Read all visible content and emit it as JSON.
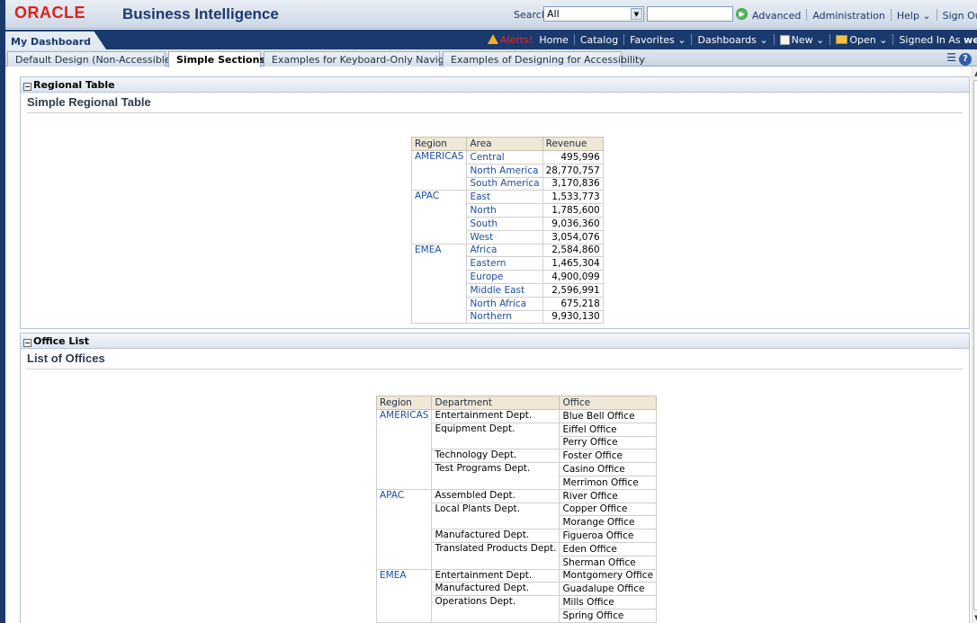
{
  "header": {
    "logo": "ORACLE",
    "app_title": "Business Intelligence",
    "search_label": "Search",
    "search_scope": "All",
    "links": [
      "Advanced",
      "Administration",
      "Help",
      "Sign Out"
    ]
  },
  "navbar": {
    "dashboard_tab": "My Dashboard",
    "alerts": "Alerts!",
    "home": "Home",
    "catalog": "Catalog",
    "favorites": "Favorites",
    "dashboards": "Dashboards",
    "new": "New",
    "open": "Open",
    "signed_in_label": "Signed In As",
    "user": "weblogic"
  },
  "page_tabs": [
    "Default Design (Non-Accessible)",
    "Simple Sections",
    "Examples for Keyboard-Only Navigation",
    "Examples of Designing for Accessibility"
  ],
  "active_tab": 1,
  "sections": {
    "regional": {
      "header": "Regional Table",
      "title": "Simple Regional Table",
      "columns": [
        "Region",
        "Area",
        "Revenue"
      ],
      "groups": [
        {
          "region": "AMERICAS",
          "rows": [
            [
              "Central",
              "495,996"
            ],
            [
              "North America",
              "28,770,757"
            ],
            [
              "South America",
              "3,170,836"
            ]
          ]
        },
        {
          "region": "APAC",
          "rows": [
            [
              "East",
              "1,533,773"
            ],
            [
              "North",
              "1,785,600"
            ],
            [
              "South",
              "9,036,360"
            ],
            [
              "West",
              "3,054,076"
            ]
          ]
        },
        {
          "region": "EMEA",
          "rows": [
            [
              "Africa",
              "2,584,860"
            ],
            [
              "Eastern",
              "1,465,304"
            ],
            [
              "Europe",
              "4,900,099"
            ],
            [
              "Middle East",
              "2,596,991"
            ],
            [
              "North Africa",
              "675,218"
            ],
            [
              "Northern",
              "9,930,130"
            ]
          ]
        }
      ]
    },
    "offices": {
      "header": "Office List",
      "title": "List of Offices",
      "columns": [
        "Region",
        "Department",
        "Office"
      ],
      "groups": [
        {
          "region": "AMERICAS",
          "depts": [
            {
              "name": "Entertainment Dept.",
              "offices": [
                "Blue Bell Office"
              ]
            },
            {
              "name": "Equipment Dept.",
              "offices": [
                "Eiffel Office",
                "Perry Office"
              ]
            },
            {
              "name": "Technology Dept.",
              "offices": [
                "Foster Office"
              ]
            },
            {
              "name": "Test Programs Dept.",
              "offices": [
                "Casino Office",
                "Merrimon Office"
              ]
            }
          ]
        },
        {
          "region": "APAC",
          "depts": [
            {
              "name": "Assembled Dept.",
              "offices": [
                "River Office"
              ]
            },
            {
              "name": "Local Plants Dept.",
              "offices": [
                "Copper Office",
                "Morange Office"
              ]
            },
            {
              "name": "Manufactured Dept.",
              "offices": [
                "Figueroa Office"
              ]
            },
            {
              "name": "Translated Products Dept.",
              "offices": [
                "Eden Office",
                "Sherman Office"
              ]
            }
          ]
        },
        {
          "region": "EMEA",
          "depts": [
            {
              "name": "Entertainment Dept.",
              "offices": [
                "Montgomery Office"
              ]
            },
            {
              "name": "Manufactured Dept.",
              "offices": [
                "Guadalupe Office"
              ]
            },
            {
              "name": "Operations Dept.",
              "offices": [
                "Mills Office",
                "Spring Office"
              ]
            }
          ]
        }
      ]
    }
  }
}
